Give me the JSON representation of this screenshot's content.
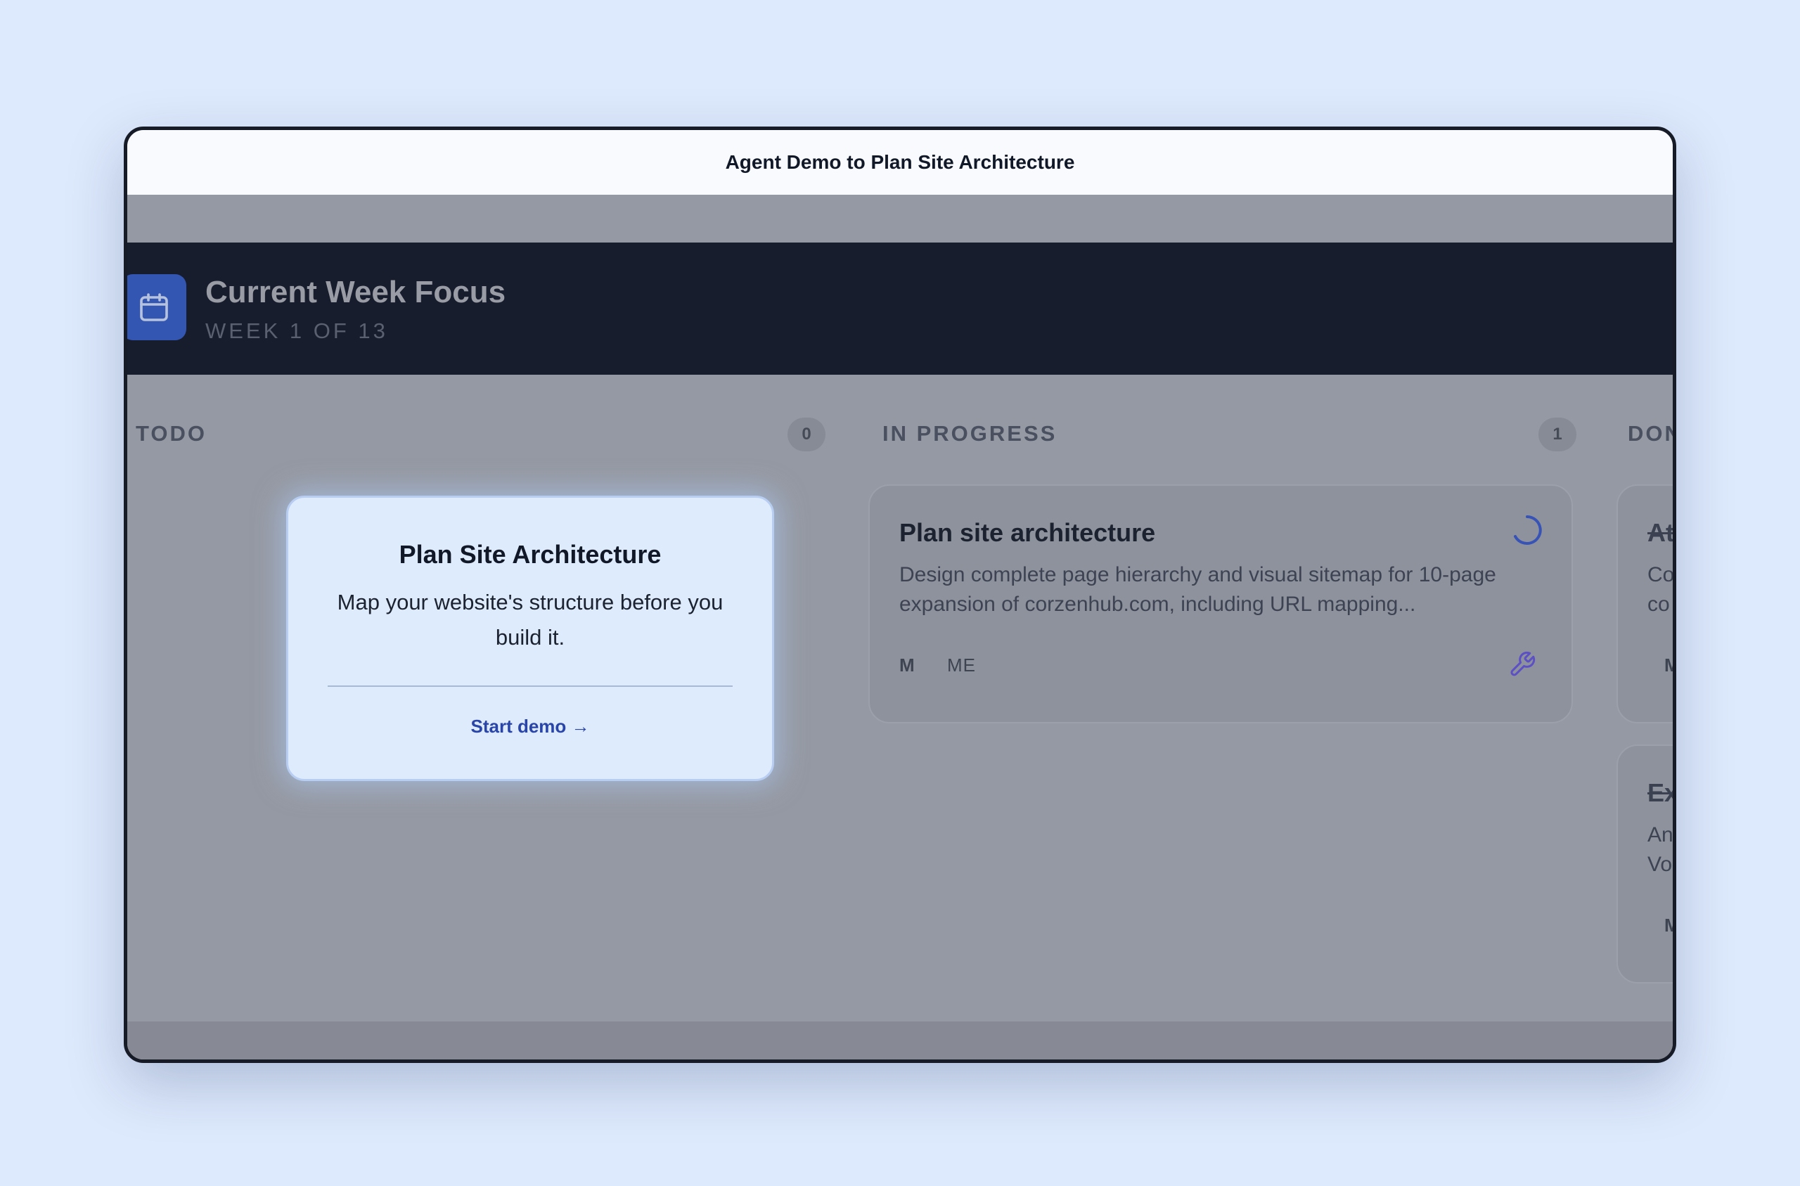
{
  "window": {
    "title": "Agent Demo to Plan Site Architecture"
  },
  "header": {
    "icon": "calendar-icon",
    "title": "Current Week Focus",
    "subtitle": "WEEK 1 OF 13"
  },
  "columns": [
    {
      "title": "TODO",
      "count": "0"
    },
    {
      "title": "IN PROGRESS",
      "count": "1"
    },
    {
      "title": "DON"
    }
  ],
  "in_progress_card": {
    "title": "Plan site architecture",
    "description": "Design complete page hierarchy and visual sitemap for 10-page expansion of corzenhub.com, including URL mapping...",
    "size": "M",
    "assignee": "ME",
    "status_icon": "spinner-icon",
    "tool_icon": "wrench-icon"
  },
  "done_cards": [
    {
      "title": "At",
      "desc_line1": "Co",
      "desc_line2": "co",
      "size": "M"
    },
    {
      "title": "Ex",
      "desc_line1": "An",
      "desc_line2": "Vo",
      "size": "M"
    }
  ],
  "popover": {
    "title": "Plan Site Architecture",
    "description": "Map your website's structure before you build it.",
    "cta": "Start demo →"
  },
  "colors": {
    "accent": "#2a45a8",
    "header_bg": "#171d2d",
    "overlay": "#9599a3",
    "popover_bg": "#deebfc",
    "icon_bg": "#3456b3",
    "wrench": "#5d4fc4"
  }
}
